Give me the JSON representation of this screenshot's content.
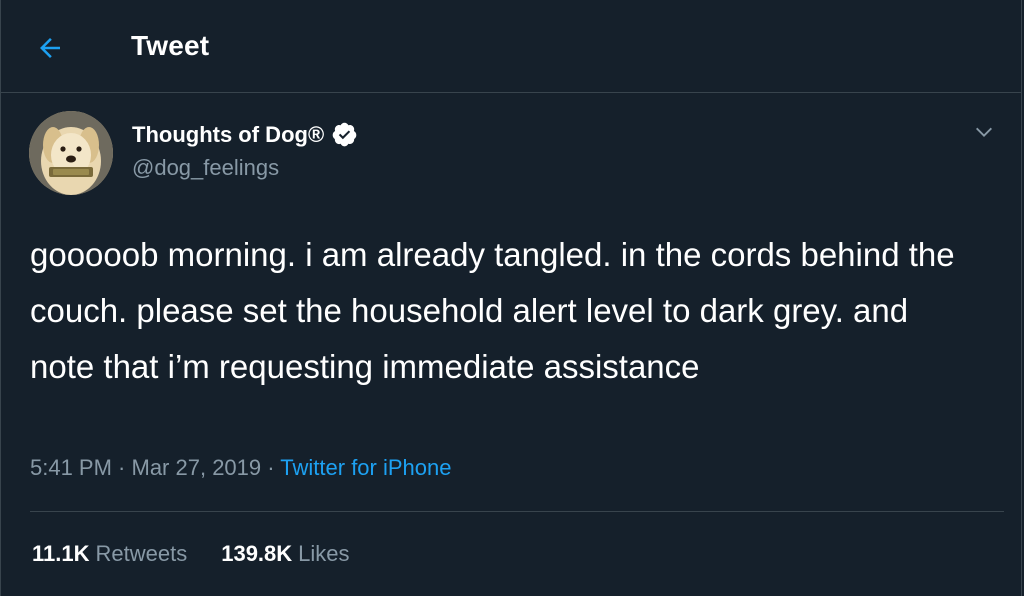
{
  "header": {
    "title": "Tweet",
    "back_icon": "arrow-left-icon"
  },
  "author": {
    "name": "Thoughts of Dog®",
    "handle": "@dog_feelings",
    "verified_icon": "verified-badge-icon",
    "avatar": "dog-avatar"
  },
  "tweet": {
    "text": "gooooob morning. i am already tangled. in the cords behind the couch. please set the household alert level to dark grey. and note that i’m requesting immediate assistance",
    "time": "5:41 PM",
    "dot1": " · ",
    "date": "Mar 27, 2019",
    "dot2": " · ",
    "source": "Twitter for iPhone",
    "menu_icon": "chevron-down-icon"
  },
  "stats": {
    "retweets_count": "11.1K",
    "retweets_label": "Retweets",
    "likes_count": "139.8K",
    "likes_label": "Likes"
  },
  "colors": {
    "background": "#15202b",
    "border": "#38444d",
    "accent": "#1da1f2",
    "muted": "#8899a6",
    "text": "#ffffff"
  }
}
